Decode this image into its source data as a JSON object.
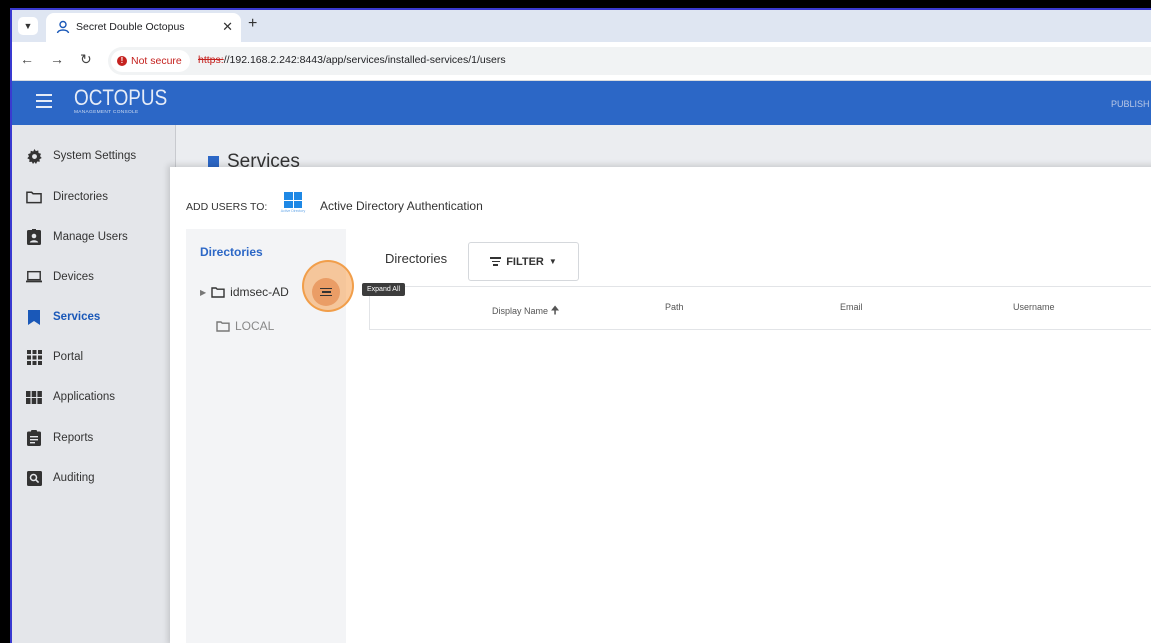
{
  "browser": {
    "tab_title": "Secret Double Octopus",
    "security_chip": "Not secure",
    "url_scheme": "https:",
    "url_rest": "//192.168.2.242:8443/app/services/installed-services/1/users"
  },
  "header": {
    "logo_main": "OCTOPUS",
    "logo_sub": "MANAGEMENT CONSOLE",
    "right_text": "PUBLISH"
  },
  "sidebar": {
    "items": [
      {
        "label": "System Settings"
      },
      {
        "label": "Directories"
      },
      {
        "label": "Manage Users"
      },
      {
        "label": "Devices"
      },
      {
        "label": "Services"
      },
      {
        "label": "Portal"
      },
      {
        "label": "Applications"
      },
      {
        "label": "Reports"
      },
      {
        "label": "Auditing"
      }
    ],
    "active": "Services"
  },
  "page": {
    "title": "Services"
  },
  "modal": {
    "add_users_to": "ADD USERS TO:",
    "service_logo_sub": "Active Directory",
    "service_name": "Active Directory Authentication",
    "tree_title": "Directories",
    "tree_items": [
      "idmsec-AD",
      "LOCAL"
    ],
    "tab_label": "Directories",
    "filter_label": "FILTER",
    "columns": [
      "Display Name",
      "Path",
      "Email",
      "Username"
    ],
    "tooltip": "Expand All"
  }
}
